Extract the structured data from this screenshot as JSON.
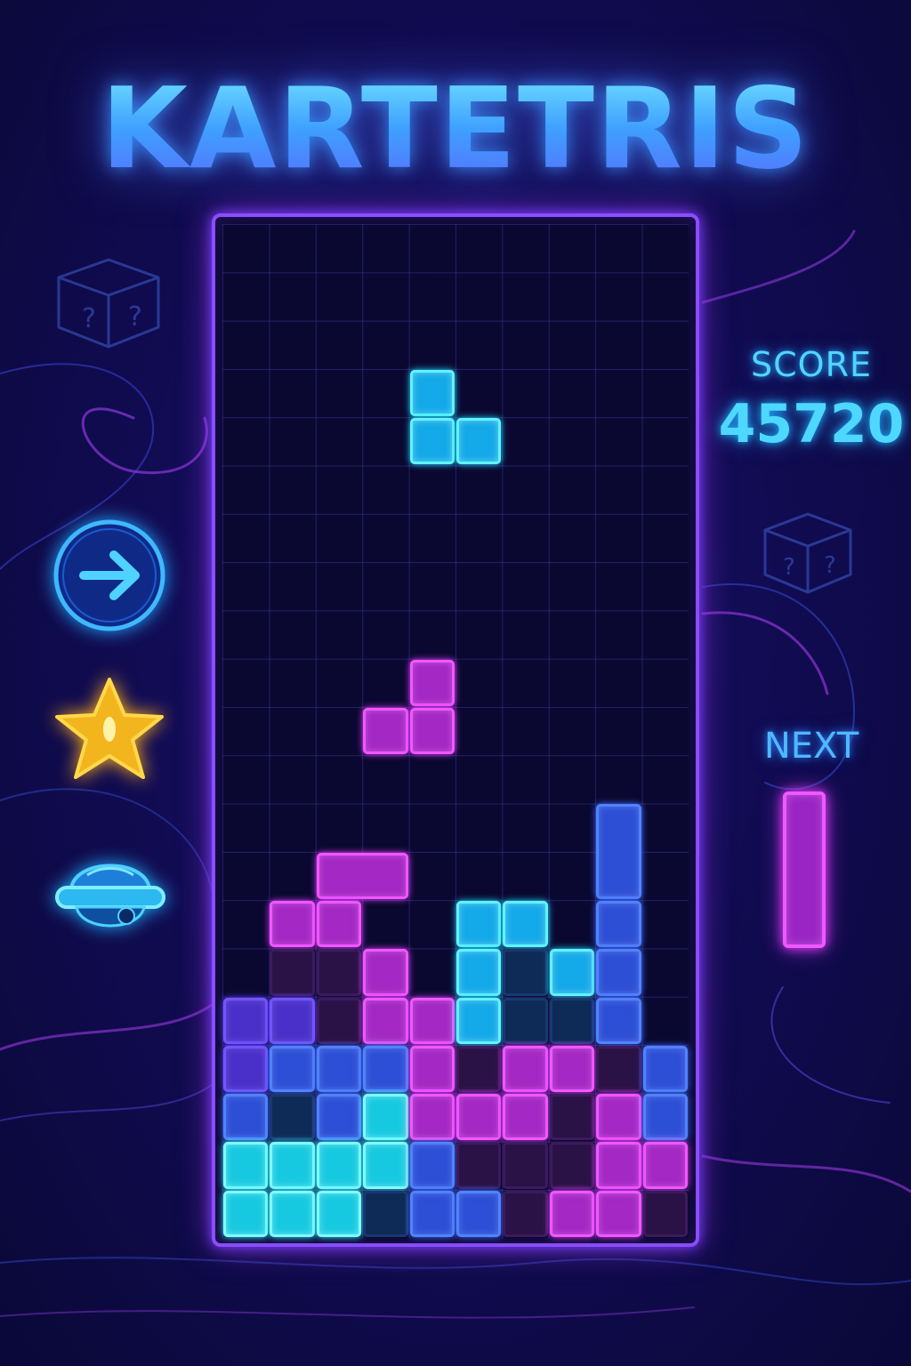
{
  "game": {
    "title": "KARTETRIS",
    "score_label": "SCORE",
    "score": "45720",
    "next_label": "NEXT",
    "next_piece": "I"
  },
  "colors": {
    "cyan": "#14a9e8",
    "magenta": "#a428c4",
    "blue": "#2d4fd6",
    "board_border": "#8a4dff",
    "title_glow": "#4fb4ff",
    "star": "#f2b51e"
  },
  "powerups": [
    {
      "name": "arrow-boost",
      "icon": "arrow-right-icon"
    },
    {
      "name": "star",
      "icon": "star-icon"
    },
    {
      "name": "blue-shell",
      "icon": "shell-icon"
    }
  ],
  "board": {
    "cols": 10,
    "rows": 21,
    "active_piece": {
      "type": "L",
      "color": "cyan",
      "cells": [
        [
          4,
          3
        ],
        [
          4,
          4
        ],
        [
          5,
          4
        ]
      ]
    },
    "ghost_piece": {
      "type": "S",
      "color": "magenta",
      "cells": [
        [
          4,
          9
        ],
        [
          3,
          10
        ],
        [
          4,
          10
        ]
      ]
    },
    "stack": [
      {
        "c": 2,
        "r": 13,
        "w": 2,
        "h": 1,
        "color": "magenta"
      },
      {
        "c": 8,
        "r": 12,
        "w": 1,
        "h": 2,
        "color": "blue"
      },
      {
        "c": 1,
        "r": 14,
        "color": "magenta"
      },
      {
        "c": 2,
        "r": 14,
        "color": "magenta"
      },
      {
        "c": 5,
        "r": 14,
        "color": "cyan"
      },
      {
        "c": 6,
        "r": 14,
        "color": "cyan"
      },
      {
        "c": 8,
        "r": 14,
        "color": "blue"
      },
      {
        "c": 1,
        "r": 15,
        "color": "ghost-m"
      },
      {
        "c": 2,
        "r": 15,
        "color": "ghost-m"
      },
      {
        "c": 3,
        "r": 15,
        "color": "magenta"
      },
      {
        "c": 5,
        "r": 15,
        "color": "cyan"
      },
      {
        "c": 6,
        "r": 15,
        "color": "ghost-b"
      },
      {
        "c": 7,
        "r": 15,
        "color": "cyan"
      },
      {
        "c": 8,
        "r": 15,
        "color": "blue"
      },
      {
        "c": 0,
        "r": 16,
        "color": "indigo"
      },
      {
        "c": 1,
        "r": 16,
        "color": "indigo"
      },
      {
        "c": 2,
        "r": 16,
        "color": "ghost-m"
      },
      {
        "c": 3,
        "r": 16,
        "color": "magenta"
      },
      {
        "c": 4,
        "r": 16,
        "color": "magenta"
      },
      {
        "c": 5,
        "r": 16,
        "color": "cyan"
      },
      {
        "c": 6,
        "r": 16,
        "color": "ghost-b"
      },
      {
        "c": 7,
        "r": 16,
        "color": "ghost-b"
      },
      {
        "c": 8,
        "r": 16,
        "color": "blue"
      },
      {
        "c": 0,
        "r": 17,
        "color": "indigo"
      },
      {
        "c": 1,
        "r": 17,
        "color": "blue"
      },
      {
        "c": 2,
        "r": 17,
        "color": "blue"
      },
      {
        "c": 3,
        "r": 17,
        "color": "blue"
      },
      {
        "c": 4,
        "r": 17,
        "color": "magenta"
      },
      {
        "c": 5,
        "r": 17,
        "color": "ghost-m"
      },
      {
        "c": 6,
        "r": 17,
        "color": "magenta"
      },
      {
        "c": 7,
        "r": 17,
        "color": "magenta"
      },
      {
        "c": 8,
        "r": 17,
        "color": "ghost-m"
      },
      {
        "c": 9,
        "r": 17,
        "color": "blue"
      },
      {
        "c": 0,
        "r": 18,
        "color": "blue"
      },
      {
        "c": 1,
        "r": 18,
        "color": "ghost-b"
      },
      {
        "c": 2,
        "r": 18,
        "color": "blue"
      },
      {
        "c": 3,
        "r": 18,
        "color": "aqua"
      },
      {
        "c": 4,
        "r": 18,
        "color": "magenta"
      },
      {
        "c": 5,
        "r": 18,
        "color": "magenta"
      },
      {
        "c": 6,
        "r": 18,
        "color": "magenta"
      },
      {
        "c": 7,
        "r": 18,
        "color": "ghost-m"
      },
      {
        "c": 8,
        "r": 18,
        "color": "magenta"
      },
      {
        "c": 9,
        "r": 18,
        "color": "blue"
      },
      {
        "c": 0,
        "r": 19,
        "color": "aqua"
      },
      {
        "c": 1,
        "r": 19,
        "color": "aqua"
      },
      {
        "c": 2,
        "r": 19,
        "color": "aqua"
      },
      {
        "c": 3,
        "r": 19,
        "color": "aqua"
      },
      {
        "c": 4,
        "r": 19,
        "color": "blue"
      },
      {
        "c": 5,
        "r": 19,
        "color": "ghost-m"
      },
      {
        "c": 6,
        "r": 19,
        "color": "ghost-m"
      },
      {
        "c": 7,
        "r": 19,
        "color": "ghost-m"
      },
      {
        "c": 8,
        "r": 19,
        "color": "magenta"
      },
      {
        "c": 9,
        "r": 19,
        "color": "magenta"
      },
      {
        "c": 0,
        "r": 20,
        "color": "aqua"
      },
      {
        "c": 1,
        "r": 20,
        "color": "aqua"
      },
      {
        "c": 2,
        "r": 20,
        "color": "aqua"
      },
      {
        "c": 3,
        "r": 20,
        "color": "ghost-b"
      },
      {
        "c": 4,
        "r": 20,
        "color": "blue"
      },
      {
        "c": 5,
        "r": 20,
        "color": "blue"
      },
      {
        "c": 6,
        "r": 20,
        "color": "ghost-m"
      },
      {
        "c": 7,
        "r": 20,
        "color": "magenta"
      },
      {
        "c": 8,
        "r": 20,
        "color": "magenta"
      },
      {
        "c": 9,
        "r": 20,
        "color": "ghost-m"
      }
    ]
  }
}
